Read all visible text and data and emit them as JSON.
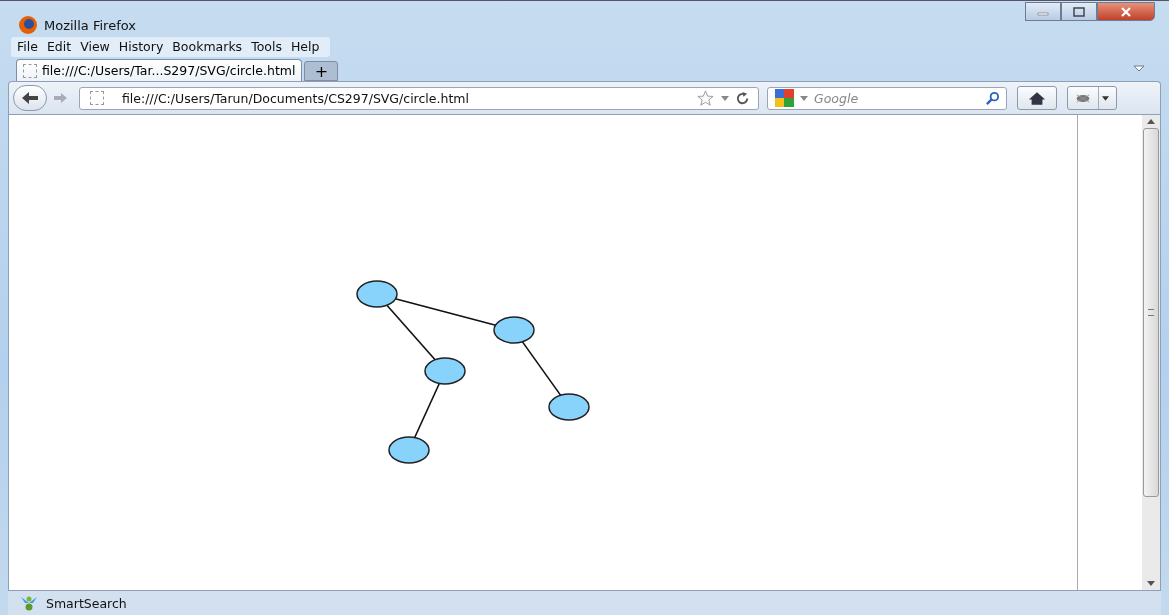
{
  "window": {
    "title": "Mozilla Firefox"
  },
  "menu": [
    {
      "label": "File"
    },
    {
      "label": "Edit"
    },
    {
      "label": "View"
    },
    {
      "label": "History"
    },
    {
      "label": "Bookmarks"
    },
    {
      "label": "Tools"
    },
    {
      "label": "Help"
    }
  ],
  "tabs": [
    {
      "label": "file:///C:/Users/Tar...S297/SVG/circle.html",
      "selected": true
    }
  ],
  "new_tab": "+",
  "address_bar": {
    "value": "file:///C:/Users/Tarun/Documents/CS297/SVG/circle.html"
  },
  "search": {
    "placeholder": "Google"
  },
  "status_bar": {
    "label": "SmartSearch"
  }
}
